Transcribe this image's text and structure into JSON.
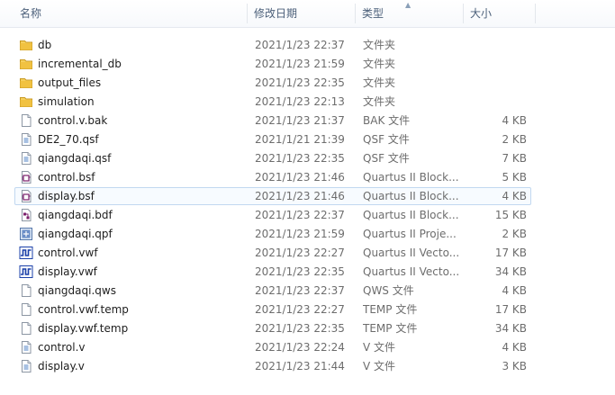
{
  "columns": {
    "name": "名称",
    "date": "修改日期",
    "type": "类型",
    "size": "大小"
  },
  "files": [
    {
      "name": "db",
      "date": "2021/1/23 22:37",
      "type": "文件夹",
      "size": "",
      "icon": "folder-icon"
    },
    {
      "name": "incremental_db",
      "date": "2021/1/23 21:59",
      "type": "文件夹",
      "size": "",
      "icon": "folder-icon"
    },
    {
      "name": "output_files",
      "date": "2021/1/23 22:35",
      "type": "文件夹",
      "size": "",
      "icon": "folder-icon"
    },
    {
      "name": "simulation",
      "date": "2021/1/23 22:13",
      "type": "文件夹",
      "size": "",
      "icon": "folder-icon"
    },
    {
      "name": "control.v.bak",
      "date": "2021/1/23 21:37",
      "type": "BAK 文件",
      "size": "4 KB",
      "icon": "blank-file-icon"
    },
    {
      "name": "DE2_70.qsf",
      "date": "2021/1/21 21:39",
      "type": "QSF 文件",
      "size": "2 KB",
      "icon": "text-file-icon"
    },
    {
      "name": "qiangdaqi.qsf",
      "date": "2021/1/23 22:35",
      "type": "QSF 文件",
      "size": "7 KB",
      "icon": "text-file-icon"
    },
    {
      "name": "control.bsf",
      "date": "2021/1/23 21:46",
      "type": "Quartus II Block...",
      "size": "5 KB",
      "icon": "block-symbol-file-icon"
    },
    {
      "name": "display.bsf",
      "date": "2021/1/23 21:46",
      "type": "Quartus II Block...",
      "size": "4 KB",
      "icon": "block-symbol-file-icon"
    },
    {
      "name": "qiangdaqi.bdf",
      "date": "2021/1/23 22:37",
      "type": "Quartus II Block...",
      "size": "15 KB",
      "icon": "block-diagram-file-icon"
    },
    {
      "name": "qiangdaqi.qpf",
      "date": "2021/1/23 21:59",
      "type": "Quartus II Proje...",
      "size": "2 KB",
      "icon": "project-file-icon"
    },
    {
      "name": "control.vwf",
      "date": "2021/1/23 22:27",
      "type": "Quartus II Vecto...",
      "size": "17 KB",
      "icon": "waveform-file-icon"
    },
    {
      "name": "display.vwf",
      "date": "2021/1/23 22:35",
      "type": "Quartus II Vecto...",
      "size": "34 KB",
      "icon": "waveform-file-icon"
    },
    {
      "name": "qiangdaqi.qws",
      "date": "2021/1/23 22:37",
      "type": "QWS 文件",
      "size": "4 KB",
      "icon": "blank-file-icon"
    },
    {
      "name": "control.vwf.temp",
      "date": "2021/1/23 22:27",
      "type": "TEMP 文件",
      "size": "17 KB",
      "icon": "blank-file-icon"
    },
    {
      "name": "display.vwf.temp",
      "date": "2021/1/23 22:35",
      "type": "TEMP 文件",
      "size": "34 KB",
      "icon": "blank-file-icon"
    },
    {
      "name": "control.v",
      "date": "2021/1/23 22:24",
      "type": "V 文件",
      "size": "4 KB",
      "icon": "text-file-icon"
    },
    {
      "name": "display.v",
      "date": "2021/1/23 21:44",
      "type": "V 文件",
      "size": "3 KB",
      "icon": "text-file-icon"
    }
  ],
  "selected_index": 8,
  "colors": {
    "folder": "#e8b63a",
    "selection_border": "#c2d8f0",
    "header_text": "#4c607a",
    "waveform": "#1a3fa8",
    "block": "#7a1f6b"
  }
}
